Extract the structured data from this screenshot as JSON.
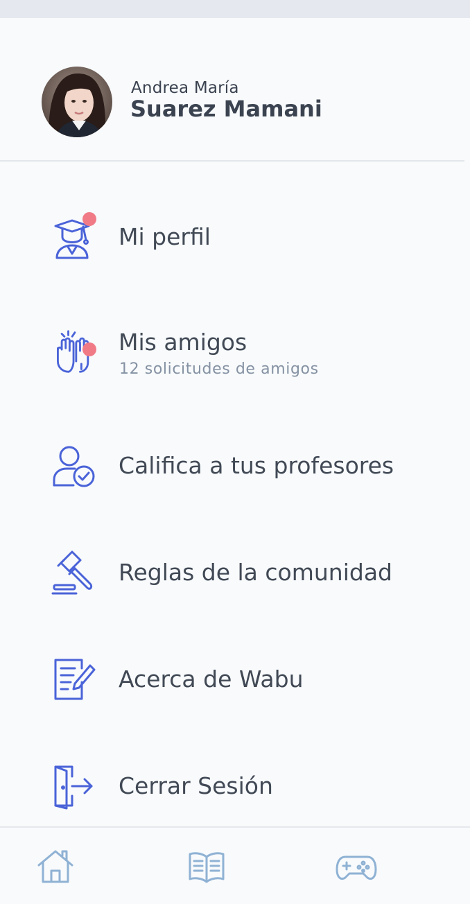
{
  "user": {
    "first_names": "Andrea María",
    "last_names": "Suarez Mamani",
    "avatar_icon": "user-photo"
  },
  "menu": [
    {
      "label": "Mi perfil",
      "icon": "graduate-icon",
      "badge": true
    },
    {
      "label": "Mis amigos",
      "sublabel": "12 solicitudes de amigos",
      "icon": "high-five-icon",
      "badge": true
    },
    {
      "label": "Califica a tus profesores",
      "icon": "user-check-icon",
      "badge": false
    },
    {
      "label": "Reglas de la comunidad",
      "icon": "gavel-icon",
      "badge": false
    },
    {
      "label": "Acerca de Wabu",
      "icon": "document-edit-icon",
      "badge": false
    },
    {
      "label": "Cerrar Sesión",
      "icon": "logout-door-icon",
      "badge": false
    }
  ],
  "bottom_nav": [
    {
      "icon": "home-icon"
    },
    {
      "icon": "book-icon"
    },
    {
      "icon": "gamepad-icon"
    }
  ],
  "colors": {
    "accent": "#4a63d8",
    "badge": "#f07b87",
    "text": "#414955",
    "subtext": "#8592a3",
    "nav_icon": "#8fb2d4"
  }
}
